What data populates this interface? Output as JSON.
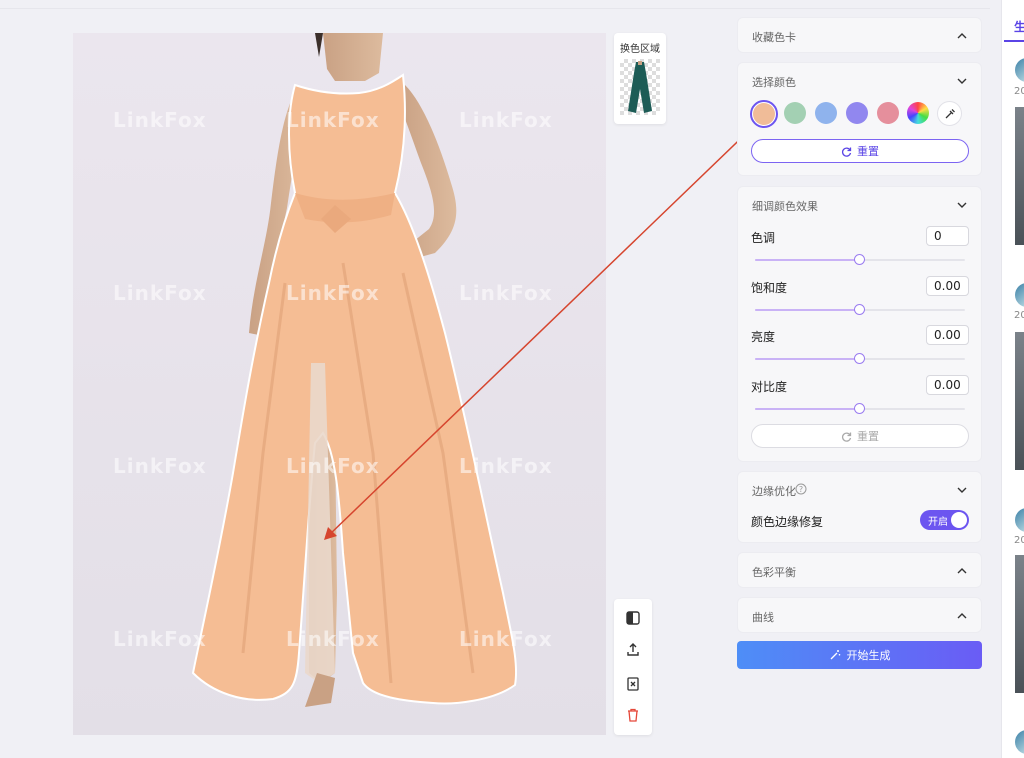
{
  "canvas": {
    "watermark_text": "LinkFox"
  },
  "thumbnail": {
    "label": "换色区域"
  },
  "toolbar": {
    "icons": [
      "compare-icon",
      "upload-icon",
      "replace-icon",
      "delete-icon"
    ]
  },
  "panels": {
    "favorites": {
      "title": "收藏色卡"
    },
    "select_color": {
      "title": "选择颜色",
      "swatches": [
        "#f0bc98",
        "#a3d0b3",
        "#8fb3ed",
        "#9187ef",
        "#e58f9c"
      ],
      "selected": "#f0bc98",
      "reset_label": "重置"
    },
    "fine_tune": {
      "title": "细调颜色效果",
      "hue_label": "色调",
      "hue_value": "0",
      "saturation_label": "饱和度",
      "saturation_value": "0.00",
      "brightness_label": "亮度",
      "brightness_value": "0.00",
      "contrast_label": "对比度",
      "contrast_value": "0.00",
      "slider_positions": [
        0.5,
        0.5,
        0.5,
        0.5
      ],
      "reset_label": "重置"
    },
    "edge": {
      "title": "边缘优化",
      "repair_label": "颜色边缘修复",
      "toggle_label": "开启",
      "toggle_on": true
    },
    "color_balance": {
      "title": "色彩平衡"
    },
    "curves": {
      "title": "曲线"
    }
  },
  "generate_button": {
    "label": "开始生成"
  },
  "sidebar": {
    "tab_label": "生",
    "year_labels": [
      "20",
      "20",
      "20"
    ]
  },
  "colors": {
    "accent": "#6c55f0",
    "dress": "#f5bd94",
    "arrow": "#d6452e"
  }
}
